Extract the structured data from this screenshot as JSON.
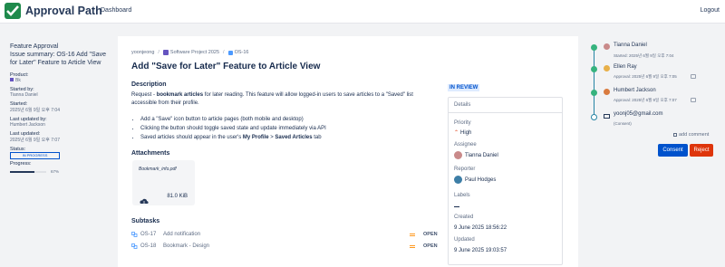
{
  "header": {
    "app_name": "Approval Path",
    "nav_dashboard": "Dashboard",
    "nav_logout": "Logout"
  },
  "sidebar": {
    "title": "Feature Approval",
    "summary": "Issue summary: OS-16 Add \"Save for Later\" Feature to Article View",
    "product_label": "Product:",
    "product_value": "Bk",
    "started_by_label": "Started by:",
    "started_by_value": "Tianna Daniel",
    "started_label": "Started:",
    "started_value": "2025년 6월 9일 오후 7:04",
    "last_updated_by_label": "Last updated by:",
    "last_updated_by_value": "Humbert Jackson",
    "last_updated_label": "Last updated:",
    "last_updated_value": "2025년 6월 9일 오후 7:07",
    "status_label": "Status:",
    "status_value": "IN PROGRESS",
    "progress_label": "Progress:",
    "progress_value": 0.67,
    "progress_text": "67%"
  },
  "issue": {
    "breadcrumb": [
      "yoonjeong",
      "Software Project 2025",
      "OS-16"
    ],
    "title": "Add \"Save for Later\" Feature to Article View",
    "description_heading": "Description",
    "description_prefix": "Request - ",
    "description_bold": "bookmark articles",
    "description_rest": " for later reading. This feature will allow logged-in users to save articles to a \"Saved\" list accessible from their profile.",
    "bullets": [
      "Add a \"Save\" icon button to article pages (both mobile and desktop)",
      "Clicking the button should toggle saved state and update immediately via API",
      "Saved articles should appear in the user's "
    ],
    "bullet3_bold1": "My Profile",
    "bullet3_arrow": " > ",
    "bullet3_bold2": "Saved Articles",
    "bullet3_tail": " tab",
    "attachments_heading": "Attachments",
    "attachment_name": "Bookmark_info.pdf",
    "attachment_size": "81.0 KiB",
    "subtasks_heading": "Subtasks",
    "subtasks": [
      {
        "key": "OS-17",
        "summary": "Add notification",
        "status": "OPEN"
      },
      {
        "key": "OS-18",
        "summary": "Bookmark - Design",
        "status": "OPEN"
      }
    ],
    "status_badge": "IN REVIEW",
    "details_heading": "Details",
    "priority_label": "Priority",
    "priority_value": "High",
    "assignee_label": "Assignee",
    "assignee_value": "Tianna Daniel",
    "reporter_label": "Reporter",
    "reporter_value": "Paul Hodges",
    "labels_label": "Labels",
    "created_label": "Created",
    "created_value": "9 June 2025 18:56:22",
    "updated_label": "Updated",
    "updated_value": "9 June 2025 19:03:57"
  },
  "timeline": {
    "steps": [
      {
        "name": "Tianna Daniel",
        "sub": "Started: 2025년 6월 9일 오후 7:04"
      },
      {
        "name": "Ellen Ray",
        "sub": "Approval: 2025년 6월 9일 오후 7:05"
      },
      {
        "name": "Humbert Jackson",
        "sub": "Approval: 2025년 6월 9일 오후 7:07"
      },
      {
        "name": "yoonj05@gmail.com",
        "sub": "(Consent)"
      }
    ],
    "add_comment": "add comment",
    "consent_label": "Consent",
    "reject_label": "Reject"
  },
  "colors": {
    "accent": "#0052cc",
    "reject": "#de350b",
    "success": "#36b37e",
    "brand": "#1f8a4c"
  }
}
